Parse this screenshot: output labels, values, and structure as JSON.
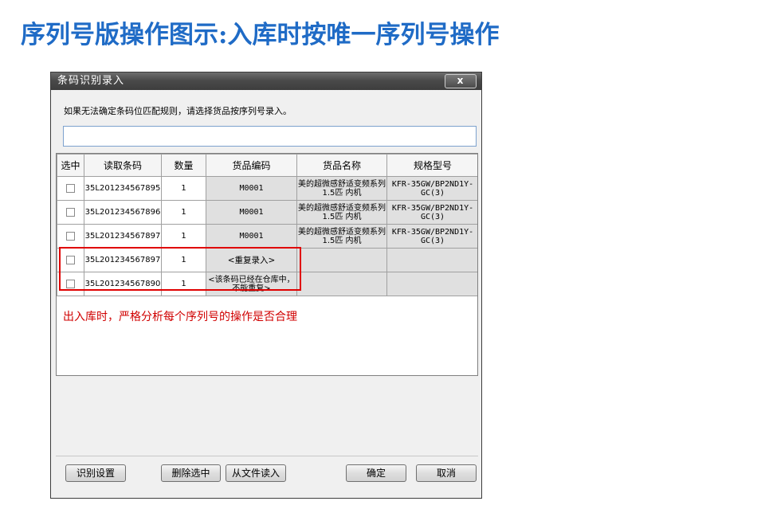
{
  "page_title": "序列号版操作图示:入库时按唯一序列号操作",
  "dialog": {
    "title": "条码识别录入",
    "close_glyph": "x",
    "instruction": "如果无法确定条码位匹配规则，请选择货品按序列号录入。",
    "input_value": "",
    "columns": [
      "选中",
      "读取条码",
      "数量",
      "货品编码",
      "货品名称",
      "规格型号"
    ],
    "rows": [
      {
        "checked": false,
        "barcode": "35L201234567895",
        "qty": "1",
        "code": "M0001",
        "name": "美的超微感舒适变频系列1.5匹 内机",
        "spec": "KFR-35GW/BP2ND1Y-GC(3)"
      },
      {
        "checked": false,
        "barcode": "35L201234567896",
        "qty": "1",
        "code": "M0001",
        "name": "美的超微感舒适变频系列1.5匹 内机",
        "spec": "KFR-35GW/BP2ND1Y-GC(3)"
      },
      {
        "checked": false,
        "barcode": "35L201234567897",
        "qty": "1",
        "code": "M0001",
        "name": "美的超微感舒适变频系列1.5匹 内机",
        "spec": "KFR-35GW/BP2ND1Y-GC(3)"
      },
      {
        "checked": false,
        "barcode": "35L201234567897",
        "qty": "1",
        "code": "<重复录入>",
        "name": "",
        "spec": ""
      },
      {
        "checked": false,
        "barcode": "35L201234567890",
        "qty": "1",
        "code": "<该条码已经在仓库中，不能重复>",
        "name": "",
        "spec": ""
      }
    ],
    "buttons": {
      "settings": "识别设置",
      "delete_selected": "删除选中",
      "read_from_file": "从文件读入",
      "ok": "确定",
      "cancel": "取消"
    }
  },
  "annotation_note": "出入库时，严格分析每个序列号的操作是否合理",
  "colors": {
    "title": "#1f6bc6",
    "highlight": "#e00000"
  }
}
